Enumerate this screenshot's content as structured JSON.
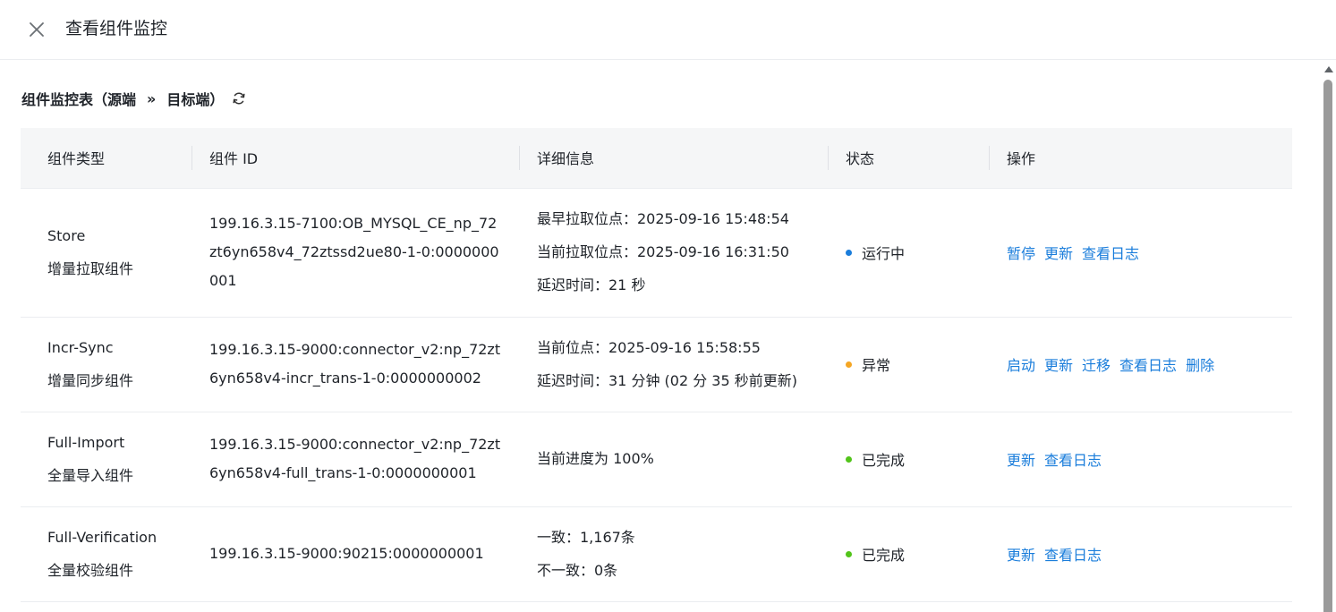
{
  "header": {
    "title": "查看组件监控",
    "close_icon": "close-icon"
  },
  "section": {
    "title_part1": "组件监控表（源端",
    "separator": "»",
    "title_part2": "目标端）",
    "refresh_icon": "refresh-icon"
  },
  "table": {
    "columns": {
      "type": "组件类型",
      "id": "组件 ID",
      "detail": "详细信息",
      "status": "状态",
      "op": "操作"
    },
    "rows": [
      {
        "type_name": "Store",
        "type_sub": "增量拉取组件",
        "id": "199.16.3.15-7100:OB_MYSQL_CE_np_72zt6yn658v4_72ztssd2ue80-1-0:0000000001",
        "details": [
          "最早拉取位点：2025-09-16 15:48:54",
          "当前拉取位点：2025-09-16 16:31:50",
          "延迟时间：21 秒"
        ],
        "status": "运行中",
        "status_color": "#1a7ddb",
        "ops": [
          "暂停",
          "更新",
          "查看日志"
        ]
      },
      {
        "type_name": "Incr-Sync",
        "type_sub": "增量同步组件",
        "id": "199.16.3.15-9000:connector_v2:np_72zt6yn658v4-incr_trans-1-0:0000000002",
        "details": [
          "当前位点：2025-09-16 15:58:55",
          "延迟时间：31 分钟 (02 分 35 秒前更新)"
        ],
        "status": "异常",
        "status_color": "#f5a623",
        "ops": [
          "启动",
          "更新",
          "迁移",
          "查看日志",
          "删除"
        ]
      },
      {
        "type_name": "Full-Import",
        "type_sub": "全量导入组件",
        "id": "199.16.3.15-9000:connector_v2:np_72zt6yn658v4-full_trans-1-0:0000000001",
        "details": [
          "当前进度为 100%"
        ],
        "status": "已完成",
        "status_color": "#52c41a",
        "ops": [
          "更新",
          "查看日志"
        ]
      },
      {
        "type_name": "Full-Verification",
        "type_sub": "全量校验组件",
        "id": "199.16.3.15-9000:90215:0000000001",
        "details": [
          "一致：1,167条",
          "不一致：0条"
        ],
        "status": "已完成",
        "status_color": "#52c41a",
        "ops": [
          "更新",
          "查看日志"
        ]
      }
    ]
  }
}
